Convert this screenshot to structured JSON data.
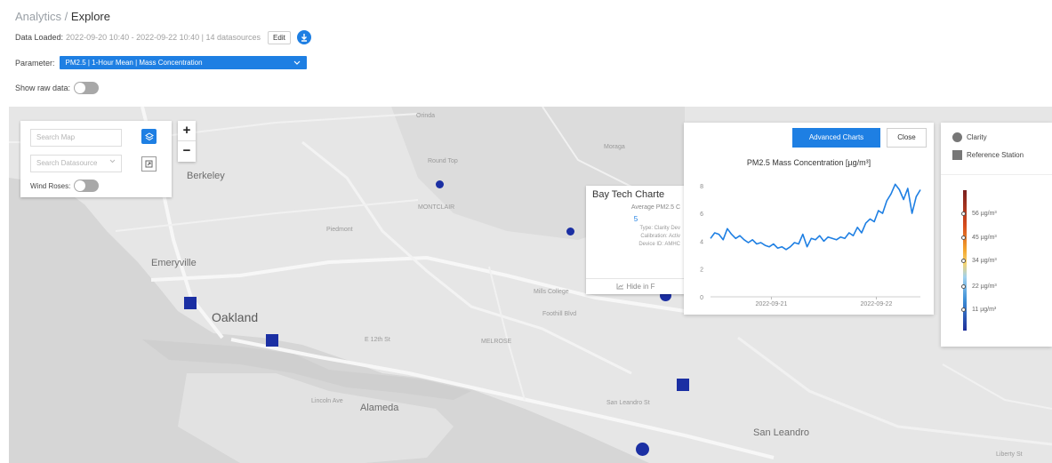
{
  "breadcrumb": {
    "section": "Analytics",
    "separator": "/",
    "current": "Explore"
  },
  "data_loaded": {
    "label": "Data Loaded:",
    "value": "2022-09-20 10:40 - 2022-09-22 10:40 | 14 datasources",
    "edit_label": "Edit"
  },
  "parameter": {
    "label": "Parameter:",
    "selected": "PM2.5 | 1-Hour Mean | Mass Concentration"
  },
  "raw_data": {
    "label": "Show raw data:",
    "enabled": false
  },
  "map_controls": {
    "search_map_placeholder": "Search Map",
    "search_datasource_placeholder": "Search Datasource",
    "wind_roses_label": "Wind Roses:",
    "wind_roses_enabled": false,
    "zoom_in": "+",
    "zoom_out": "−"
  },
  "map_labels": {
    "orinda": "Orinda",
    "moraga": "Moraga",
    "berkeley": "Berkeley",
    "piedmont": "Piedmont",
    "emeryville": "Emeryville",
    "oakland": "Oakland",
    "alameda": "Alameda",
    "san_leandro": "San Leandro",
    "round_top": "Round Top",
    "mills_college": "Mills College",
    "foothill_blvd": "Foothill Blvd",
    "e12th": "E 12th St",
    "melrose": "MELROSE",
    "lincoln_ave": "Lincoln Ave",
    "montclair": "MONTCLAIR",
    "san_leandro_st": "San Leandro St",
    "liberty_st": "Liberty St"
  },
  "popup": {
    "title": "Bay Tech Charte",
    "average_label": "Average PM2.5 C",
    "value": "5",
    "type_line": "Type: Clarity Dev",
    "calibration_line": "Calibration: Activ",
    "device_line": "Device ID: AMHC",
    "hide_label": "Hide in F"
  },
  "chart_panel": {
    "advanced_label": "Advanced Charts",
    "close_label": "Close"
  },
  "chart_data": {
    "type": "line",
    "title": "PM2.5 Mass Concentration [µg/m³]",
    "xlabel": "",
    "ylabel": "",
    "ylim": [
      0,
      8.5
    ],
    "yticks": [
      0,
      2,
      4,
      6,
      8
    ],
    "xticks": [
      "2022-09-21",
      "2022-09-22"
    ],
    "x_range_days": [
      0,
      2.0
    ],
    "xtick_positions_days": [
      0.58,
      1.58
    ],
    "series": [
      {
        "x": [
          0.0,
          0.04,
          0.08,
          0.12,
          0.16,
          0.2,
          0.24,
          0.28,
          0.32,
          0.36,
          0.4,
          0.44,
          0.48,
          0.52,
          0.56,
          0.6,
          0.64,
          0.68,
          0.72,
          0.76,
          0.8,
          0.84,
          0.88,
          0.92,
          0.96,
          1.0,
          1.04,
          1.08,
          1.12,
          1.16,
          1.2,
          1.24,
          1.28,
          1.32,
          1.36,
          1.4,
          1.44,
          1.48,
          1.52,
          1.56,
          1.6,
          1.64,
          1.68,
          1.72,
          1.76,
          1.8,
          1.84,
          1.88,
          1.92,
          1.96,
          2.0
        ],
        "values": [
          4.2,
          4.6,
          4.5,
          4.1,
          4.9,
          4.5,
          4.2,
          4.4,
          4.1,
          3.9,
          4.1,
          3.8,
          3.9,
          3.7,
          3.6,
          3.8,
          3.5,
          3.6,
          3.4,
          3.6,
          3.9,
          3.8,
          4.5,
          3.6,
          4.2,
          4.1,
          4.4,
          4.0,
          4.3,
          4.2,
          4.1,
          4.3,
          4.2,
          4.6,
          4.4,
          5.0,
          4.6,
          5.3,
          5.6,
          5.4,
          6.2,
          6.0,
          6.9,
          7.4,
          8.1,
          7.7,
          7.0,
          7.8,
          6.0,
          7.2,
          7.7
        ]
      }
    ]
  },
  "legend": {
    "items": [
      {
        "label": "Clarity",
        "shape": "circle"
      },
      {
        "label": "Reference Station",
        "shape": "square"
      }
    ],
    "scale_ticks": [
      "56 µg/m³",
      "45 µg/m³",
      "34 µg/m³",
      "22 µg/m³",
      "11 µg/m³"
    ],
    "colors": {
      "accent": "#1e7fe3",
      "marker": "#1b2fa3"
    }
  }
}
